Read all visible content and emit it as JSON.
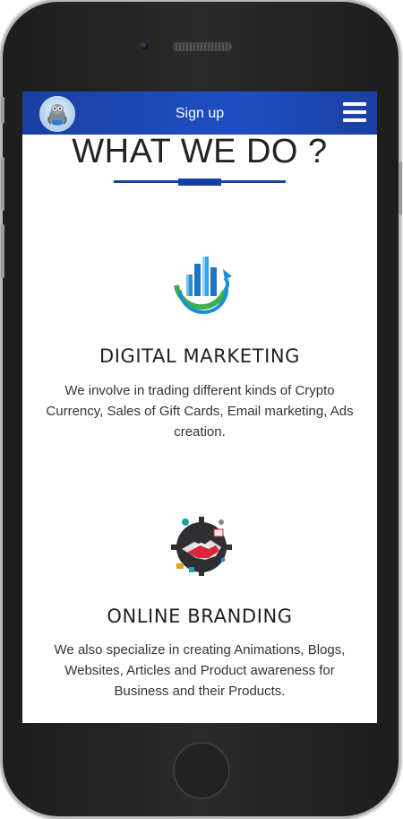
{
  "navbar": {
    "logo_icon": "bird-mascot-icon",
    "signup_label": "Sign up",
    "menu_icon": "hamburger-menu-icon"
  },
  "section": {
    "title": "WHAT WE DO ?"
  },
  "services": [
    {
      "icon": "bar-chart-growth-icon",
      "title": "DIGITAL MARKETING",
      "description": "We involve in trading different kinds of Crypto Currency, Sales of Gift Cards, Email marketing, Ads creation."
    },
    {
      "icon": "handshake-gear-icon",
      "title": "ONLINE BRANDING",
      "description": "We also specialize in creating Animations, Blogs, Websites, Articles and Product awareness for Business and their Products."
    }
  ],
  "colors": {
    "navbar": "#1f4fc2",
    "accent": "#1a3fa3",
    "text": "#222222"
  }
}
